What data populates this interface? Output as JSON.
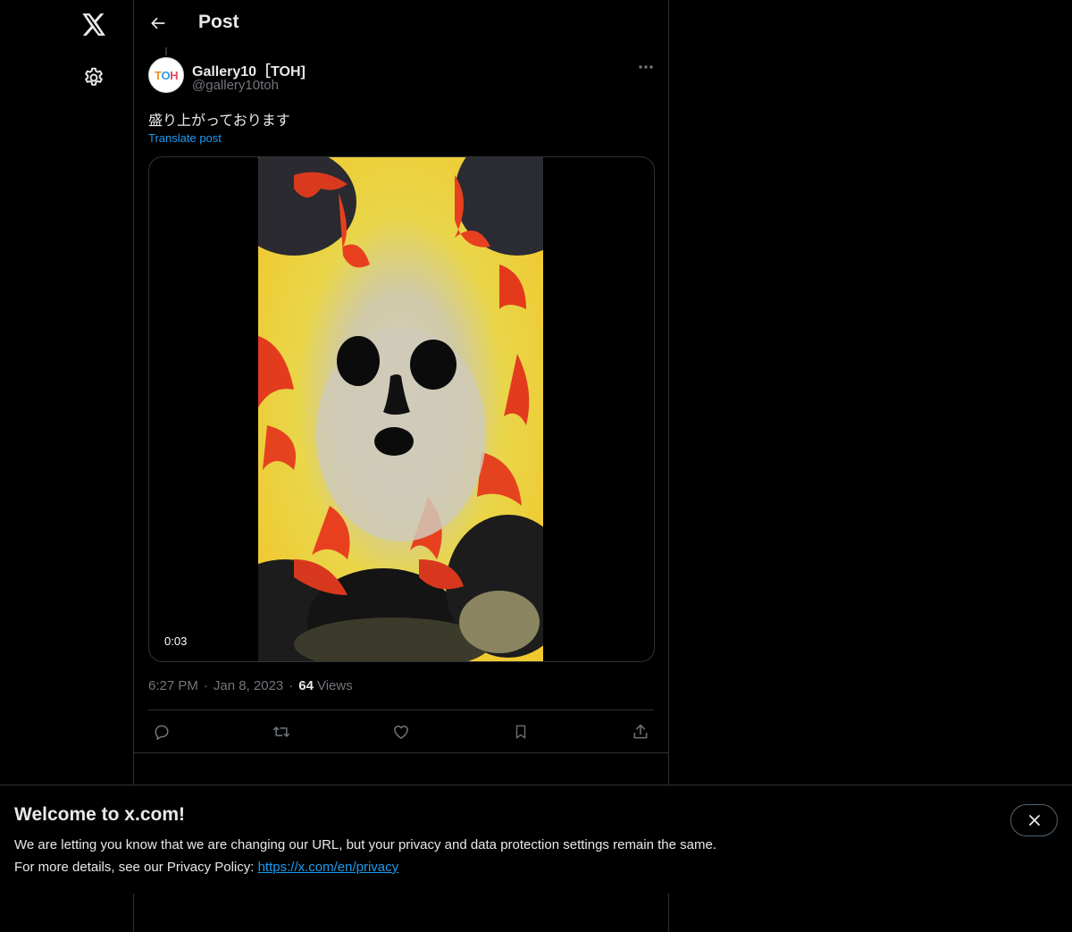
{
  "header": {
    "title": "Post"
  },
  "post": {
    "author_name": "Gallery10［TOH]",
    "author_handle": "@gallery10toh",
    "avatar_text": "TOH",
    "text": "盛り上がっております",
    "translate_label": "Translate post",
    "video_duration": "0:03",
    "time": "6:27 PM",
    "separator": "·",
    "date": "Jan 8, 2023",
    "views_count": "64",
    "views_label": "Views"
  },
  "banner": {
    "title": "Welcome to x.com!",
    "line1": "We are letting you know that we are changing our URL, but your privacy and data protection settings remain the same.",
    "line2_prefix": "For more details, see our Privacy Policy: ",
    "privacy_link": "https://x.com/en/privacy"
  },
  "colors": {
    "background": "#000000",
    "text": "#e7e9ea",
    "secondary_text": "#71767b",
    "accent": "#1d9bf0",
    "border": "#2f3336"
  },
  "icons": {
    "logo": "x-logo-icon",
    "settings": "gear-icon",
    "back": "arrow-left-icon",
    "more": "more-dots-icon",
    "reply": "reply-icon",
    "repost": "repost-icon",
    "like": "heart-icon",
    "bookmark": "bookmark-icon",
    "share": "share-icon",
    "close": "close-icon"
  }
}
